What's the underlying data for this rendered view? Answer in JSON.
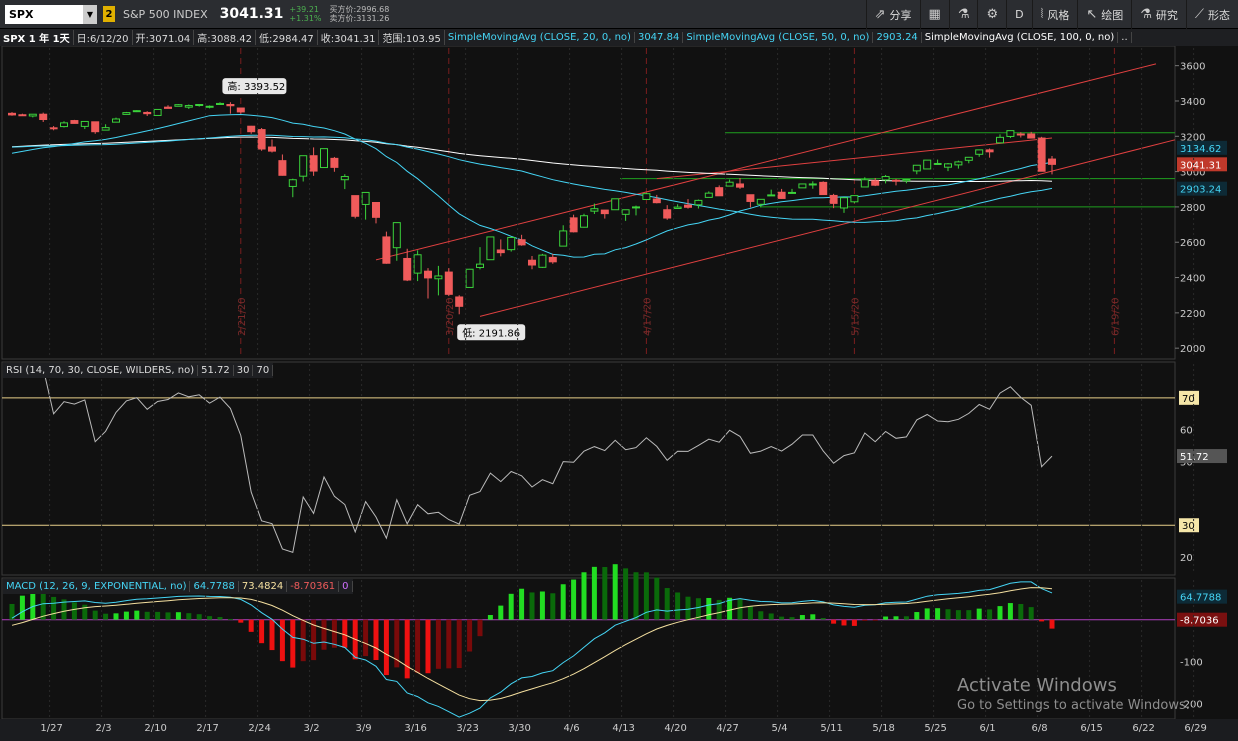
{
  "header": {
    "symbol": "SPX",
    "link_badge": "2",
    "name": "S&P 500 INDEX",
    "price": "3041.31",
    "change": "+39.21",
    "change_pct": "+1.31%",
    "bid": "买方价:2996.68",
    "ask": "卖方价:3131.26"
  },
  "toolbar": [
    {
      "icon": "share-icon",
      "glyph": "⇗",
      "label": "分享"
    },
    {
      "icon": "calendar-icon",
      "glyph": "▦",
      "label": ""
    },
    {
      "icon": "flask-icon",
      "glyph": "⚗",
      "label": ""
    },
    {
      "icon": "gear-icon",
      "glyph": "⚙",
      "label": ""
    },
    {
      "icon": "period-icon",
      "glyph": "",
      "label": "D"
    },
    {
      "icon": "style-icon",
      "glyph": "⦚",
      "label": "风格"
    },
    {
      "icon": "drawing-icon",
      "glyph": "↖",
      "label": "绘图"
    },
    {
      "icon": "studies-icon",
      "glyph": "⚗",
      "label": "研究"
    },
    {
      "icon": "patterns-icon",
      "glyph": "⟋",
      "label": "形态"
    }
  ],
  "infobar": {
    "title": "SPX 1 年 1天",
    "date": "日:6/12/20",
    "open": "开:3071.04",
    "high": "高:3088.42",
    "low": "低:2984.47",
    "close": "收:3041.31",
    "range": "范围:103.95",
    "sma20": "SimpleMovingAvg (CLOSE, 20, 0, no)",
    "sma20_val": "3047.84",
    "sma50": "SimpleMovingAvg (CLOSE, 50, 0, no)",
    "sma50_val": "2903.24",
    "sma100": "SimpleMovingAvg (CLOSE, 100, 0, no)",
    "more": ".."
  },
  "price_panel": {
    "ticks": [
      "3600",
      "3400",
      "3200",
      "3000",
      "2800",
      "2600",
      "2400",
      "2200",
      "2000"
    ],
    "high_label": "高: 3393.52",
    "low_label": "低: 2191.86",
    "tag_upper": "3134.62",
    "tag_price": "3041.31",
    "tag_lower": "2903.24",
    "event_dates": [
      "2/21/20",
      "3/20/20",
      "4/17/20",
      "5/15/20",
      "6/19/20"
    ]
  },
  "rsi_panel": {
    "label": "RSI (14, 70, 30, CLOSE, WILDERS, no)",
    "value": "51.72",
    "low": "30",
    "high": "70",
    "ticks": [
      "70",
      "60",
      "50",
      "30",
      "20"
    ],
    "tag": "51.72"
  },
  "macd_panel": {
    "label": "MACD (12, 26, 9, EXPONENTIAL, no)",
    "value": "64.7788",
    "avg": "73.4824",
    "diff": "-8.70361",
    "zero": "0",
    "ticks": [
      "-100",
      "-200"
    ],
    "tag_value": "64.7788",
    "tag_diff": "-8.7036"
  },
  "x_axis": [
    "1/27",
    "2/3",
    "2/10",
    "2/17",
    "2/24",
    "3/2",
    "3/9",
    "3/16",
    "3/23",
    "3/30",
    "4/6",
    "4/13",
    "4/20",
    "4/27",
    "5/4",
    "5/11",
    "5/18",
    "5/25",
    "6/1",
    "6/8",
    "6/15",
    "6/22",
    "6/29"
  ],
  "watermark": {
    "line1": "Activate Windows",
    "line2": "Go to Settings to activate Windows."
  },
  "colors": {
    "up": "#3bd33b",
    "down": "#ef5b5b",
    "sma20": "#45d5f5",
    "sma50": "#45d5f5",
    "sma100": "#ffffff",
    "rsi": "#bbbbbb",
    "macd": "#45d5f5",
    "signal": "#f5e0a0",
    "channel": "#e04040",
    "level": "#1fa01f"
  },
  "chart_data": {
    "type": "candlestick",
    "dates": [
      "1/21",
      "1/22",
      "1/23",
      "1/24",
      "1/27",
      "1/28",
      "1/29",
      "1/30",
      "1/31",
      "2/3",
      "2/4",
      "2/5",
      "2/6",
      "2/7",
      "2/10",
      "2/11",
      "2/12",
      "2/13",
      "2/14",
      "2/18",
      "2/19",
      "2/20",
      "2/21",
      "2/24",
      "2/25",
      "2/26",
      "2/27",
      "2/28",
      "3/2",
      "3/3",
      "3/4",
      "3/5",
      "3/6",
      "3/9",
      "3/10",
      "3/11",
      "3/12",
      "3/13",
      "3/16",
      "3/17",
      "3/18",
      "3/19",
      "3/20",
      "3/23",
      "3/24",
      "3/25",
      "3/26",
      "3/27",
      "3/30",
      "3/31",
      "4/1",
      "4/2",
      "4/3",
      "4/6",
      "4/7",
      "4/8",
      "4/9",
      "4/13",
      "4/14",
      "4/15",
      "4/16",
      "4/17",
      "4/20",
      "4/21",
      "4/22",
      "4/23",
      "4/24",
      "4/27",
      "4/28",
      "4/29",
      "4/30",
      "5/1",
      "5/4",
      "5/5",
      "5/6",
      "5/7",
      "5/8",
      "5/11",
      "5/12",
      "5/13",
      "5/14",
      "5/15",
      "5/18",
      "5/19",
      "5/20",
      "5/21",
      "5/22",
      "5/26",
      "5/27",
      "5/28",
      "5/29",
      "6/1",
      "6/2",
      "6/3",
      "6/4",
      "6/5",
      "6/8",
      "6/9",
      "6/10",
      "6/11",
      "6/12"
    ],
    "open": [
      3330,
      3322,
      3315,
      3325,
      3248,
      3255,
      3289,
      3256,
      3282,
      3235,
      3280,
      3324,
      3344,
      3335,
      3318,
      3365,
      3370,
      3365,
      3378,
      3369,
      3380,
      3380,
      3360,
      3257,
      3238,
      3139,
      3062,
      2916,
      2974,
      3090,
      3023,
      3075,
      2954,
      2864,
      2814,
      2825,
      2630,
      2569,
      2508,
      2425,
      2436,
      2393,
      2431,
      2290,
      2344,
      2457,
      2501,
      2556,
      2558,
      2614,
      2498,
      2458,
      2514,
      2578,
      2738,
      2685,
      2776,
      2782,
      2784,
      2758,
      2800,
      2842,
      2845,
      2784,
      2791,
      2810,
      2812,
      2854,
      2909,
      2918,
      2930,
      2869,
      2815,
      2868,
      2883,
      2878,
      2908,
      2930,
      2939,
      2865,
      2794,
      2829,
      2913,
      2948,
      2953,
      2951,
      2948,
      3004,
      3015,
      3046,
      3025,
      3038,
      3064,
      3098,
      3123,
      3163,
      3199,
      3213,
      3213,
      3190,
      3071
    ],
    "high": [
      3337,
      3328,
      3326,
      3334,
      3258,
      3285,
      3293,
      3285,
      3283,
      3268,
      3306,
      3338,
      3348,
      3342,
      3353,
      3376,
      3382,
      3380,
      3381,
      3375,
      3393,
      3393,
      3360,
      3259,
      3247,
      3182,
      3097,
      2960,
      3091,
      3137,
      3131,
      3083,
      2985,
      2863,
      2883,
      2825,
      2660,
      2712,
      2563,
      2554,
      2453,
      2466,
      2453,
      2300,
      2449,
      2572,
      2632,
      2616,
      2631,
      2642,
      2522,
      2534,
      2534,
      2696,
      2756,
      2761,
      2819,
      2782,
      2846,
      2783,
      2807,
      2880,
      2868,
      2810,
      2815,
      2844,
      2842,
      2888,
      2922,
      2955,
      2964,
      2869,
      2844,
      2898,
      2902,
      2902,
      2930,
      2945,
      2945,
      2874,
      2853,
      2865,
      2968,
      2964,
      2981,
      2959,
      2956,
      3021,
      3036,
      3068,
      3049,
      3062,
      3082,
      3123,
      3131,
      3211,
      3232,
      3223,
      3225,
      3197,
      3088
    ],
    "low": [
      3316,
      3318,
      3307,
      3281,
      3234,
      3250,
      3272,
      3241,
      3214,
      3233,
      3280,
      3324,
      3337,
      3315,
      3318,
      3365,
      3370,
      3355,
      3368,
      3358,
      3378,
      3328,
      3328,
      3214,
      3118,
      3108,
      2977,
      2855,
      2944,
      2976,
      3023,
      2999,
      2901,
      2735,
      2728,
      2707,
      2478,
      2495,
      2380,
      2380,
      2281,
      2299,
      2295,
      2192,
      2344,
      2446,
      2501,
      2520,
      2547,
      2580,
      2447,
      2455,
      2478,
      2578,
      2655,
      2683,
      2760,
      2734,
      2784,
      2721,
      2752,
      2842,
      2820,
      2727,
      2792,
      2790,
      2791,
      2854,
      2863,
      2918,
      2902,
      2797,
      2798,
      2866,
      2846,
      2875,
      2908,
      2903,
      2887,
      2793,
      2766,
      2821,
      2913,
      2918,
      2933,
      2922,
      2934,
      2985,
      3015,
      3046,
      3003,
      3017,
      3047,
      3084,
      3079,
      3163,
      3190,
      3193,
      3194,
      3050,
      2984
    ],
    "close": [
      3321,
      3321,
      3325,
      3295,
      3244,
      3276,
      3273,
      3284,
      3226,
      3249,
      3298,
      3334,
      3345,
      3328,
      3352,
      3358,
      3379,
      3374,
      3380,
      3370,
      3386,
      3373,
      3338,
      3226,
      3128,
      3116,
      2979,
      2954,
      3090,
      3003,
      3130,
      3024,
      2972,
      2747,
      2882,
      2741,
      2481,
      2711,
      2386,
      2529,
      2398,
      2409,
      2305,
      2237,
      2447,
      2476,
      2630,
      2541,
      2627,
      2585,
      2471,
      2527,
      2489,
      2664,
      2659,
      2750,
      2790,
      2762,
      2846,
      2784,
      2800,
      2875,
      2824,
      2737,
      2799,
      2798,
      2837,
      2878,
      2863,
      2940,
      2912,
      2831,
      2843,
      2868,
      2848,
      2882,
      2930,
      2930,
      2870,
      2820,
      2852,
      2864,
      2954,
      2923,
      2972,
      2949,
      2955,
      3036,
      3065,
      3046,
      3044,
      3055,
      3081,
      3123,
      3112,
      3194,
      3232,
      3208,
      3190,
      3002,
      3041
    ],
    "sma20_last": 3047.84,
    "sma50_last": 2903.24,
    "period_high": 3393.52,
    "period_low": 2191.86,
    "price_ylim": [
      1950,
      3700
    ],
    "rsi": {
      "ylim": [
        15,
        80
      ],
      "last": 51.72
    },
    "macd": {
      "value": 64.7788,
      "avg": 73.4824,
      "diff": -8.70361
    }
  }
}
